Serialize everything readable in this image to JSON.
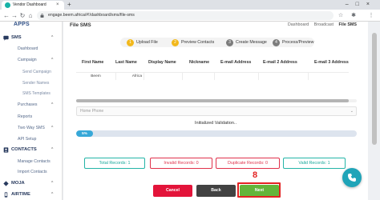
{
  "browser": {
    "tab_title": "Vendor Dashboard",
    "tab_close": "×",
    "new_tab": "+",
    "url": "engage.beem.africa/#!/dashboard/sms/file-sms",
    "window_controls": "–□×",
    "nav": {
      "back": "←",
      "forward": "→",
      "reload": "↻",
      "home": "⌂"
    },
    "toolbar_icons": {
      "star": "☆",
      "extensions": "✱",
      "menu": "⋮"
    }
  },
  "sidebar": {
    "apps": "APPS",
    "sections": {
      "sms": "SMS",
      "contacts": "CONTACTS",
      "moja": "MOJA",
      "airtime": "AIRTIME"
    },
    "chevron": "^",
    "items": {
      "dashboard": "Dashboard",
      "campaign": "Campaign",
      "purchases": "Purchases",
      "reports": "Reports",
      "two_way_sms": "Two Way SMS",
      "api_setup": "API Setup",
      "manage_contacts": "Manage Contacts",
      "import_contacts": "Import Contacts"
    },
    "campaign_sub": [
      "Send Campaign",
      "Sender Names",
      "SMS Templates"
    ]
  },
  "page": {
    "title": "File SMS",
    "breadcrumbs": [
      "Dashboard",
      "Broadcast",
      "File SMS"
    ]
  },
  "steps": [
    {
      "num": "1",
      "label": "Upload File"
    },
    {
      "num": "2",
      "label": "Preview Contacts"
    },
    {
      "num": "3",
      "label": "Create Message"
    },
    {
      "num": "4",
      "label": "Process/Preview"
    }
  ],
  "table": {
    "headers": [
      "First Name",
      "Last Name",
      "Display Name",
      "Nickname",
      "E-mail Address",
      "E-mail 2 Address",
      "E-mail 3 Address"
    ],
    "row": [
      "Beem",
      "Africa",
      "",
      "",
      "",
      "",
      ""
    ]
  },
  "column_select": {
    "value": "Home Phone",
    "arrow": "⌄"
  },
  "validation": {
    "text": "Initialized Validation..",
    "progress_label": "5%",
    "progress": 0.05
  },
  "counters": {
    "total": "Total Records: 1",
    "invalid": "Invalid Records: 0",
    "duplicate": "Duplicate Records: 0",
    "valid": "Valid Records: 1"
  },
  "buttons": {
    "cancel": "Cancel",
    "back": "Back",
    "next": "Next"
  },
  "annotation": "8",
  "colors": {
    "accent_teal": "#17b2a7",
    "invalid_red": "#e0314b",
    "cancel_red": "#e3143a",
    "back_dark": "#424242",
    "next_green": "#63b53a",
    "step_active": "#f2b81b",
    "progress_blue": "#37a8d8",
    "chat_fab": "#1fa4b8"
  },
  "icons": [
    "lock-icon",
    "sms-icon",
    "contacts-icon",
    "moja-icon",
    "airtime-icon",
    "chat-icon"
  ]
}
